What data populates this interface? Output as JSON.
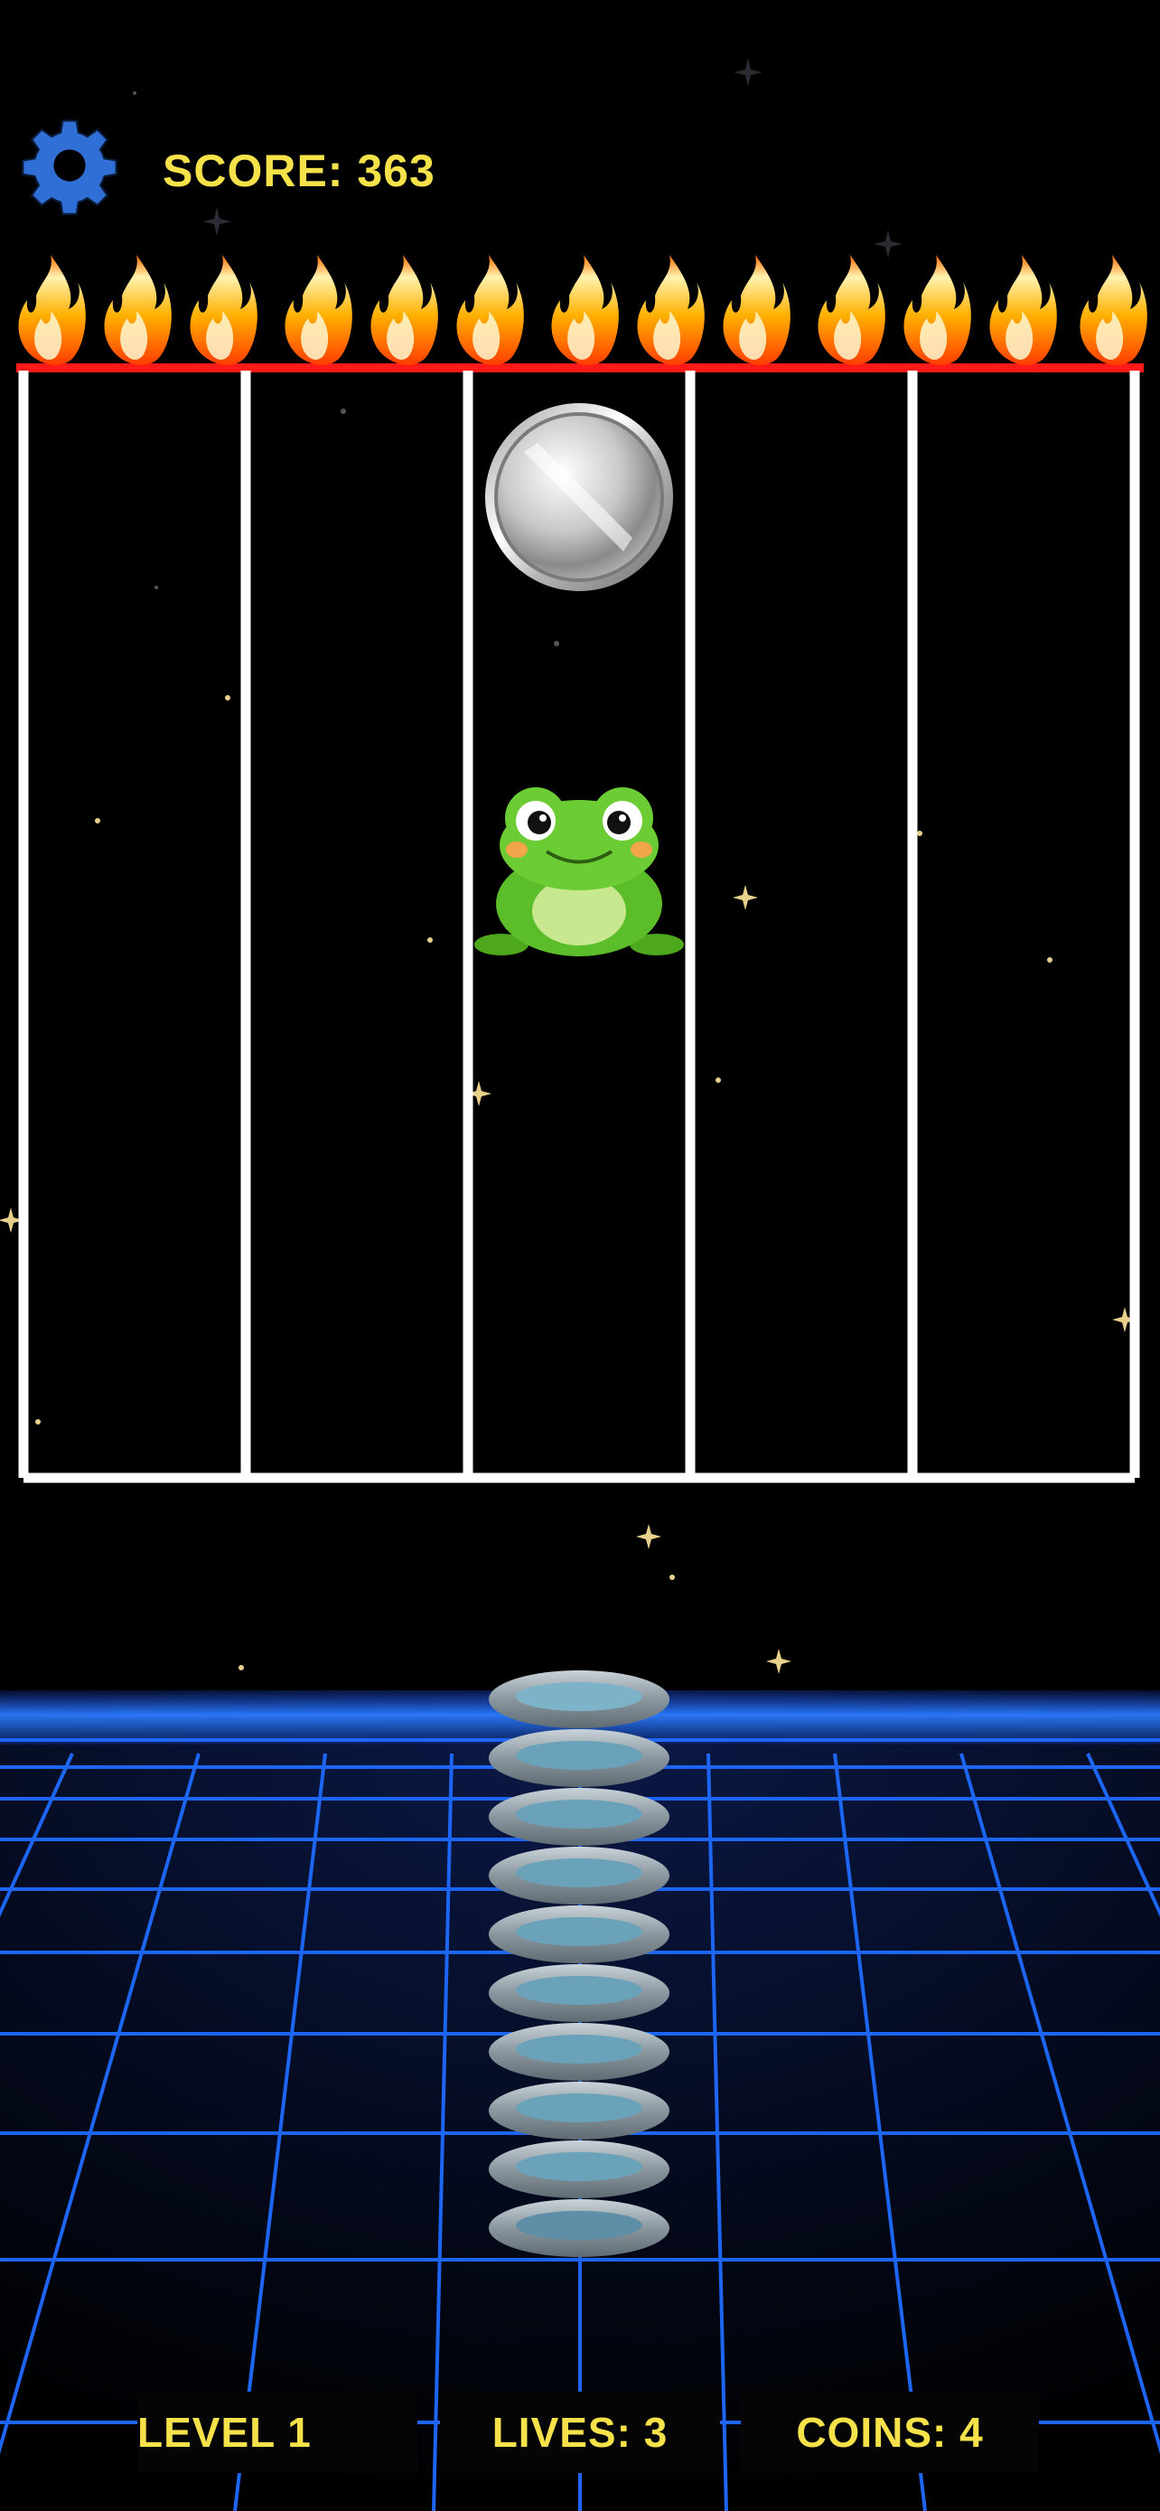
{
  "hud": {
    "settings_icon": "gear-icon",
    "score_text": "SCORE: 363"
  },
  "board": {
    "columns": 5,
    "hazard": "fire-row",
    "coin_column": 3,
    "player_column": 3
  },
  "footer": {
    "level_text": "LEVEL 1",
    "lives_text": "LIVES: 3",
    "coins_text": "COINS: 4"
  },
  "colors": {
    "hud_text": "#f5e14a",
    "gear": "#2f6fd6",
    "grid": "#1f6bff",
    "fire_line": "#ff1a1a",
    "column_lines": "#ffffff"
  }
}
